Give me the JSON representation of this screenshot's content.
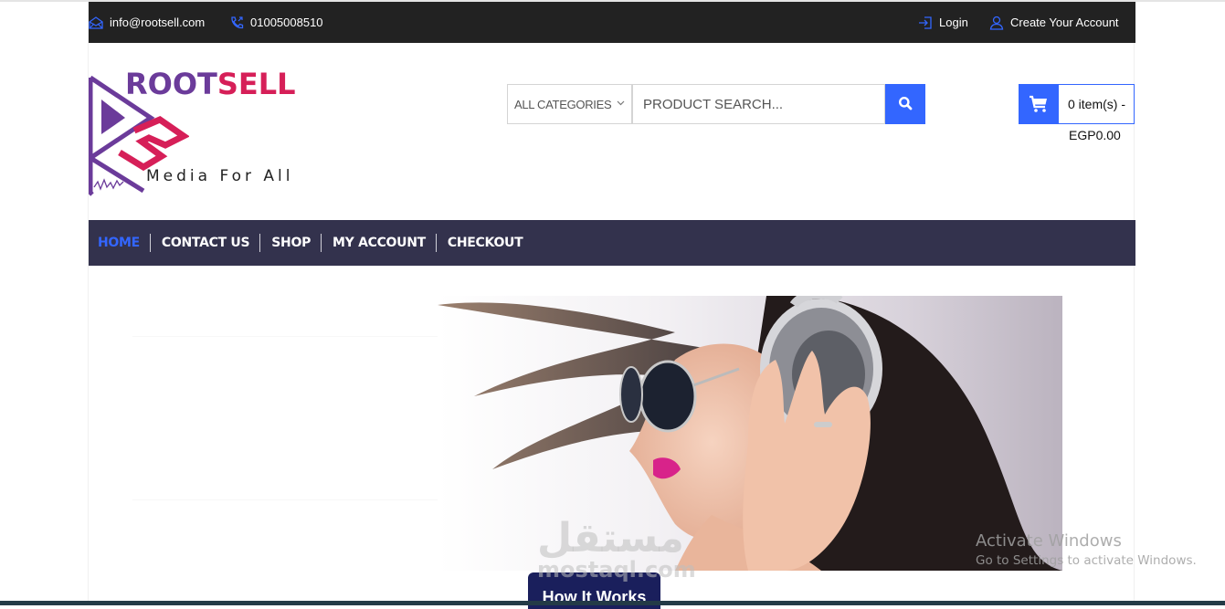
{
  "topbar": {
    "email": "info@rootsell.com",
    "phone": "01005008510",
    "login_label": "Login",
    "create_account_label": "Create Your Account",
    "icon_color": "#3366ff",
    "background": "#222222"
  },
  "logo": {
    "brand_part1": "ROOT",
    "brand_part2": "SELL",
    "tagline": "Media For All",
    "colors": {
      "purple": "#6b3b9a",
      "pink": "#d61f58"
    }
  },
  "search": {
    "category_selected": "ALL CATEGORIES",
    "placeholder": "PRODUCT SEARCH...",
    "button_icon": "search-icon"
  },
  "cart": {
    "items_label": "0 item(s) -",
    "total": "EGP0.00",
    "icon": "cart-icon"
  },
  "nav": {
    "items": [
      {
        "label": "HOME",
        "active": true
      },
      {
        "label": "CONTACT US",
        "active": false
      },
      {
        "label": "SHOP",
        "active": false
      },
      {
        "label": "MY ACCOUNT",
        "active": false
      },
      {
        "label": "CHECKOUT",
        "active": false
      }
    ],
    "background": "#33324d",
    "active_color": "#3366ff"
  },
  "hero": {
    "alt": "Woman with sunglasses wearing headphones"
  },
  "cta": {
    "how_it_works_label": "How It Works"
  },
  "overlays": {
    "watermark_arabic": "مستقل",
    "watermark_latin": "mostaql.com",
    "activate_title": "Activate Windows",
    "activate_subtitle": "Go to Settings to activate Windows."
  }
}
